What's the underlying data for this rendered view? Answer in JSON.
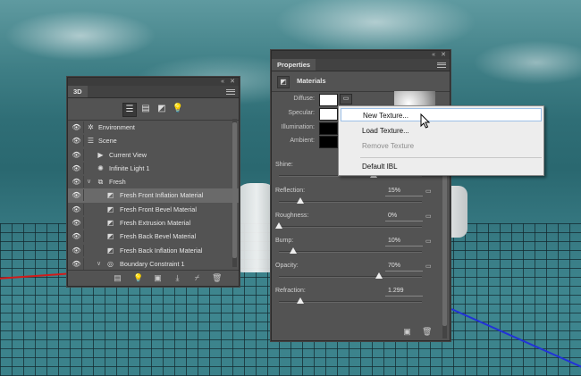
{
  "panel3d": {
    "tab": "3D",
    "tree": [
      {
        "label": "Environment",
        "icon": "environment-icon"
      },
      {
        "label": "Scene",
        "icon": "scene-icon"
      },
      {
        "label": "Current View",
        "icon": "camera-icon"
      },
      {
        "label": "Infinite Light 1",
        "icon": "light-icon"
      },
      {
        "label": "Fresh",
        "icon": "mesh-icon"
      },
      {
        "label": "Fresh Front Inflation Material",
        "icon": "material-icon"
      },
      {
        "label": "Fresh Front Bevel Material",
        "icon": "material-icon"
      },
      {
        "label": "Fresh Extrusion Material",
        "icon": "material-icon"
      },
      {
        "label": "Fresh Back Bevel Material",
        "icon": "material-icon"
      },
      {
        "label": "Fresh Back Inflation Material",
        "icon": "material-icon"
      },
      {
        "label": "Boundary Constraint 1",
        "icon": "constraint-icon"
      }
    ]
  },
  "properties": {
    "tab": "Properties",
    "section": "Materials",
    "colors": {
      "diffuse": {
        "label": "Diffuse:",
        "color": "#ffffff"
      },
      "specular": {
        "label": "Specular:",
        "color": "#ffffff"
      },
      "illumination": {
        "label": "Illumination:",
        "color": "#000000"
      },
      "ambient": {
        "label": "Ambient:",
        "color": "#000000"
      }
    },
    "sliders": [
      {
        "label": "Shine:",
        "value": "",
        "level": 0.66
      },
      {
        "label": "Reflection:",
        "value": "15%",
        "level": 0.15
      },
      {
        "label": "Roughness:",
        "value": "0%",
        "level": 0.0
      },
      {
        "label": "Bump:",
        "value": "10%",
        "level": 0.1
      },
      {
        "label": "Opacity:",
        "value": "70%",
        "level": 0.7
      },
      {
        "label": "Refraction:",
        "value": "1.299",
        "level": 0.15
      }
    ]
  },
  "context_menu": {
    "items": [
      {
        "label": "New Texture...",
        "state": "highlighted"
      },
      {
        "label": "Load Texture...",
        "state": "normal"
      },
      {
        "label": "Remove Texture",
        "state": "disabled"
      },
      {
        "label": "Default IBL",
        "state": "normal"
      }
    ]
  },
  "accent_colors": {
    "red_axis": "#d21a1a",
    "blue_axis": "#2232d8",
    "selection": "#6a6a6a"
  }
}
